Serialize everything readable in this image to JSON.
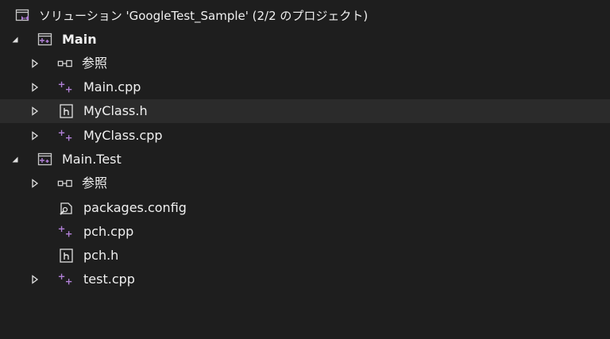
{
  "solution": {
    "label": "ソリューション 'GoogleTest_Sample' (2/2 のプロジェクト)",
    "icon": "vs-solution-icon"
  },
  "projects": [
    {
      "label": "Main",
      "icon": "cpp-project-icon",
      "expanded": true,
      "items": [
        {
          "label": "参照",
          "icon": "references-icon",
          "expandable": true
        },
        {
          "label": "Main.cpp",
          "icon": "cpp-file-icon",
          "expandable": true
        },
        {
          "label": "MyClass.h",
          "icon": "header-file-icon",
          "expandable": true,
          "selected": true
        },
        {
          "label": "MyClass.cpp",
          "icon": "cpp-file-icon",
          "expandable": true
        }
      ]
    },
    {
      "label": "Main.Test",
      "icon": "cpp-project-icon",
      "expanded": true,
      "items": [
        {
          "label": "参照",
          "icon": "references-icon",
          "expandable": true
        },
        {
          "label": "packages.config",
          "icon": "config-file-icon",
          "expandable": false
        },
        {
          "label": "pch.cpp",
          "icon": "cpp-file-icon",
          "expandable": false
        },
        {
          "label": "pch.h",
          "icon": "header-file-icon",
          "expandable": false
        },
        {
          "label": "test.cpp",
          "icon": "cpp-file-icon",
          "expandable": true
        }
      ]
    }
  ],
  "colors": {
    "background": "#1e1e1e",
    "selected_row": "#2b2b2b",
    "accent_purple": "#b180d7",
    "text": "#f0f0f0"
  }
}
